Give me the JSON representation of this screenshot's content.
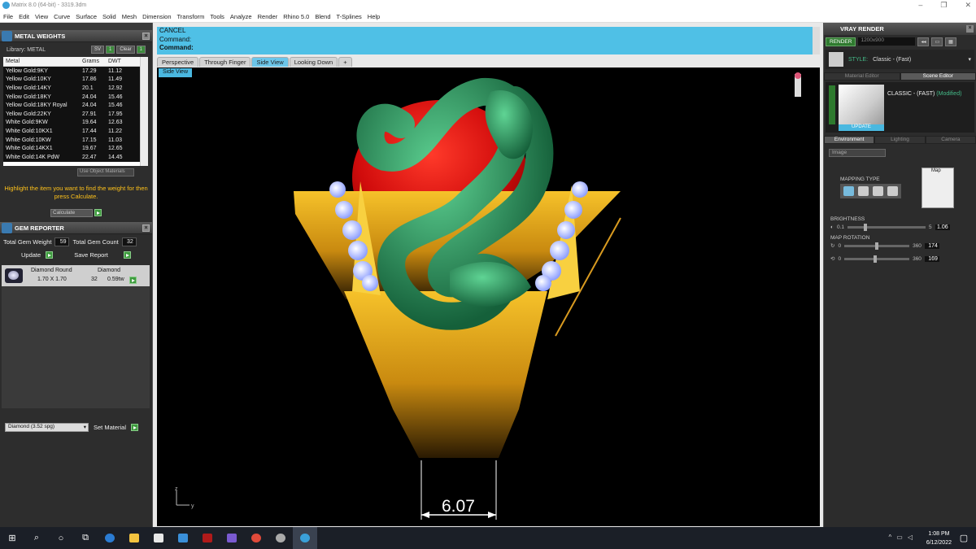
{
  "window": {
    "title": "Matrix 8.0 (64-bit) - 3319.3dm",
    "controls": [
      "–",
      "❐",
      "✕"
    ]
  },
  "menu": [
    "File",
    "Edit",
    "View",
    "Curve",
    "Surface",
    "Solid",
    "Mesh",
    "Dimension",
    "Transform",
    "Tools",
    "Analyze",
    "Render",
    "Rhino 5.0",
    "Blend",
    "T-Splines",
    "Help"
  ],
  "metal_weights": {
    "title": "METAL WEIGHTS",
    "library_label": "Library: METAL",
    "lib_buttons": [
      "SV",
      "1",
      "Clear",
      "1"
    ],
    "columns": [
      "Metal",
      "Grams",
      "DWT"
    ],
    "rows": [
      [
        "Yellow Gold:9KY",
        "17.29",
        "11.12"
      ],
      [
        "Yellow Gold:10KY",
        "17.86",
        "11.49"
      ],
      [
        "Yellow Gold:14KY",
        "20.1",
        "12.92"
      ],
      [
        "Yellow Gold:18KY",
        "24.04",
        "15.46"
      ],
      [
        "Yellow Gold:18KY Royal",
        "24.04",
        "15.46"
      ],
      [
        "Yellow Gold:22KY",
        "27.91",
        "17.95"
      ],
      [
        "White Gold:9KW",
        "19.64",
        "12.63"
      ],
      [
        "White Gold:10KX1",
        "17.44",
        "11.22"
      ],
      [
        "White Gold:10KW",
        "17.15",
        "11.03"
      ],
      [
        "White Gold:14KX1",
        "19.67",
        "12.65"
      ],
      [
        "White Gold:14K PdW",
        "22.47",
        "14.45"
      ]
    ],
    "use_object_materials": "Use Object Materials",
    "hint": "Highlight the item you want to find the weight for then press Calculate.",
    "calculate": "Calculate"
  },
  "gem_reporter": {
    "title": "GEM REPORTER",
    "total_weight_label": "Total Gem Weight",
    "total_weight": "59",
    "total_count_label": "Total Gem Count",
    "total_count": "32",
    "update": "Update",
    "save_report": "Save Report",
    "gem_header": [
      "Diamond Round",
      "Diamond"
    ],
    "gem_size": "1.70 X 1.70",
    "gem_count": "32",
    "gem_weight": "0.59tw"
  },
  "material": {
    "selected": "Diamond    (3.52 spg)",
    "set_label": "Set Material"
  },
  "command": {
    "line1": "CANCEL",
    "line2": "Command:",
    "line3": "Command:"
  },
  "tabs": [
    "Perspective",
    "Through Finger",
    "Side View",
    "Looking Down",
    "+"
  ],
  "viewport": {
    "label": "Side View",
    "dimension": "6.07",
    "axis_z": "z",
    "axis_y": "y"
  },
  "vray": {
    "title": "VRAY RENDER",
    "render": "RENDER",
    "resolution": "1200x900",
    "preset_label": "STYLE:",
    "preset": "Classic - (Fast)",
    "editor_tabs": [
      "Material Editor",
      "Scene Editor"
    ],
    "material_name": "CLASSIC - (FAST)",
    "modified": "(Modified)",
    "update": "UPDATE",
    "env_tabs": [
      "Environment",
      "Lighting",
      "Camera"
    ],
    "env_select": "Image",
    "mapping_type": "MAPPING TYPE",
    "map_label": "Map",
    "brightness_label": "BRIGHTNESS",
    "brightness_min": "0.1",
    "brightness_max": "5",
    "brightness": "1.06",
    "map_rotation_label": "MAP ROTATION",
    "rot_min": "0",
    "rot_max": "360",
    "rotation_h": "174",
    "rotation_v": "169"
  },
  "taskbar": {
    "time": "1:08 PM",
    "date": "6/12/2022"
  },
  "colors": {
    "accent": "#4fc0e6",
    "gold": "#f2b21b",
    "jade": "#2f9a5e",
    "ruby": "#d41010"
  }
}
